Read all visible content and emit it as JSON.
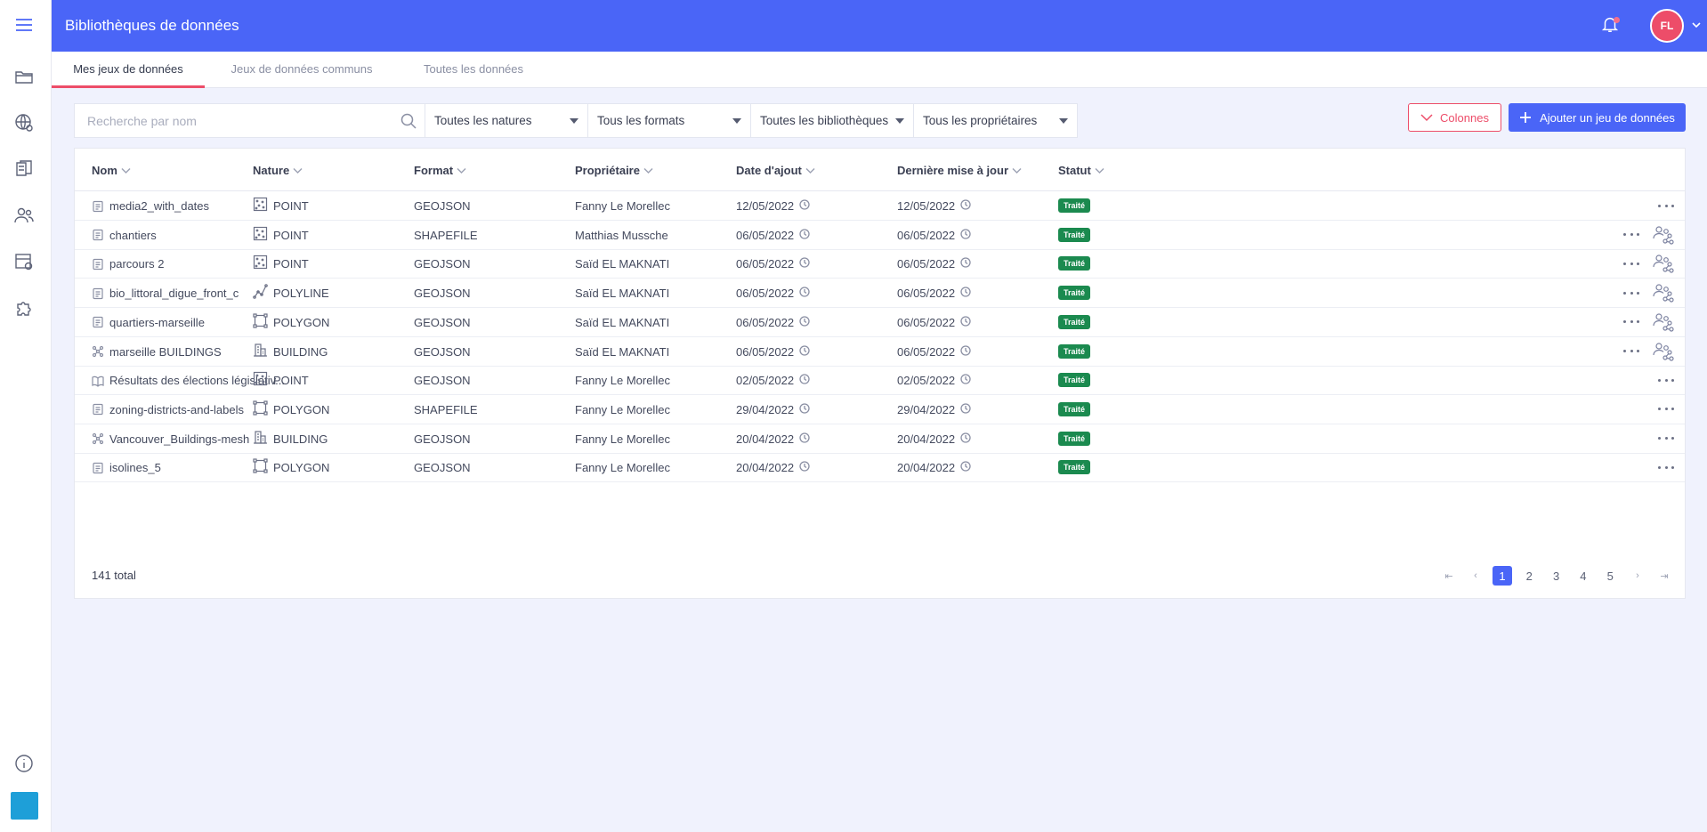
{
  "app": {
    "title": "Bibliothèques de données"
  },
  "user": {
    "initials": "FL"
  },
  "tabs": [
    {
      "label": "Mes jeux de données",
      "active": true
    },
    {
      "label": "Jeux de données communs",
      "active": false
    },
    {
      "label": "Toutes les données",
      "active": false
    }
  ],
  "filters": {
    "search_placeholder": "Recherche par nom",
    "selects": [
      "Toutes les natures",
      "Tous les formats",
      "Toutes les bibliothèques",
      "Tous les propriétaires"
    ]
  },
  "actions": {
    "columns_label": "Colonnes",
    "add_label": "Ajouter un jeu de données"
  },
  "table": {
    "headers": [
      "Nom",
      "Nature",
      "Format",
      "Propriétaire",
      "Date d'ajout",
      "Dernière mise à jour",
      "Statut"
    ],
    "rows": [
      {
        "name": "media2_with_dates",
        "name_icon": "document-icon",
        "nature": "POINT",
        "nature_icon": "point-icon",
        "format": "GEOJSON",
        "owner": "Fanny Le Morellec",
        "added": "12/05/2022",
        "updated": "12/05/2022",
        "status": "Traité",
        "shared": false
      },
      {
        "name": "chantiers",
        "name_icon": "document-icon",
        "nature": "POINT",
        "nature_icon": "point-icon",
        "format": "SHAPEFILE",
        "owner": "Matthias Mussche",
        "added": "06/05/2022",
        "updated": "06/05/2022",
        "status": "Traité",
        "shared": true
      },
      {
        "name": "parcours 2",
        "name_icon": "document-icon",
        "nature": "POINT",
        "nature_icon": "point-icon",
        "format": "GEOJSON",
        "owner": "Saïd EL MAKNATI",
        "added": "06/05/2022",
        "updated": "06/05/2022",
        "status": "Traité",
        "shared": true
      },
      {
        "name": "bio_littoral_digue_front_c",
        "name_icon": "document-icon",
        "nature": "POLYLINE",
        "nature_icon": "polyline-icon",
        "format": "GEOJSON",
        "owner": "Saïd EL MAKNATI",
        "added": "06/05/2022",
        "updated": "06/05/2022",
        "status": "Traité",
        "shared": true
      },
      {
        "name": "quartiers-marseille",
        "name_icon": "document-icon",
        "nature": "POLYGON",
        "nature_icon": "polygon-icon",
        "format": "GEOJSON",
        "owner": "Saïd EL MAKNATI",
        "added": "06/05/2022",
        "updated": "06/05/2022",
        "status": "Traité",
        "shared": true
      },
      {
        "name": "marseille BUILDINGS",
        "name_icon": "mesh-icon",
        "nature": "BUILDING",
        "nature_icon": "building-icon",
        "format": "GEOJSON",
        "owner": "Saïd EL MAKNATI",
        "added": "06/05/2022",
        "updated": "06/05/2022",
        "status": "Traité",
        "shared": true
      },
      {
        "name": "Résultats des élections législativ...",
        "name_icon": "book-icon",
        "nature": "POINT",
        "nature_icon": "point-icon",
        "format": "GEOJSON",
        "owner": "Fanny Le Morellec",
        "added": "02/05/2022",
        "updated": "02/05/2022",
        "status": "Traité",
        "shared": false
      },
      {
        "name": "zoning-districts-and-labels",
        "name_icon": "document-icon",
        "nature": "POLYGON",
        "nature_icon": "polygon-icon",
        "format": "SHAPEFILE",
        "owner": "Fanny Le Morellec",
        "added": "29/04/2022",
        "updated": "29/04/2022",
        "status": "Traité",
        "shared": false
      },
      {
        "name": "Vancouver_Buildings-mesh",
        "name_icon": "mesh-icon",
        "nature": "BUILDING",
        "nature_icon": "building-icon",
        "format": "GEOJSON",
        "owner": "Fanny Le Morellec",
        "added": "20/04/2022",
        "updated": "20/04/2022",
        "status": "Traité",
        "shared": false
      },
      {
        "name": "isolines_5",
        "name_icon": "document-icon",
        "nature": "POLYGON",
        "nature_icon": "polygon-icon",
        "format": "GEOJSON",
        "owner": "Fanny Le Morellec",
        "added": "20/04/2022",
        "updated": "20/04/2022",
        "status": "Traité",
        "shared": false
      }
    ]
  },
  "footer": {
    "total": "141 total",
    "pages": [
      "1",
      "2",
      "3",
      "4",
      "5"
    ],
    "current_page": "1",
    "first_glyph": "⇤",
    "prev_glyph": "‹",
    "next_glyph": "›",
    "last_glyph": "⇥"
  },
  "colors": {
    "primary": "#4a65f7",
    "accent": "#ed4d69",
    "status_ok": "#1b8a4f"
  }
}
